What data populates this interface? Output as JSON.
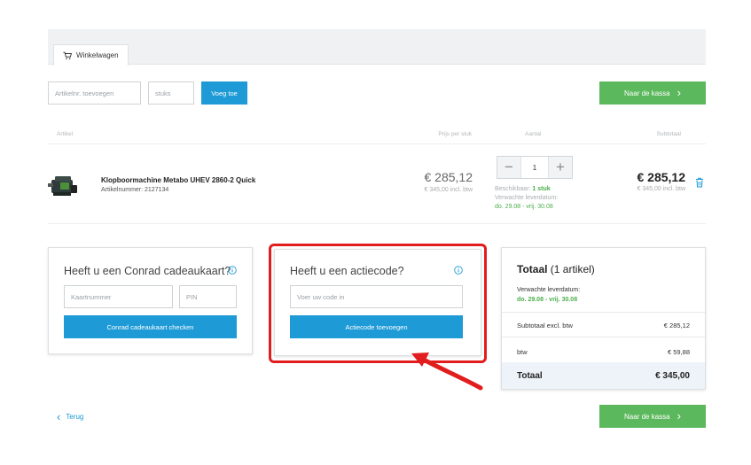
{
  "tab": {
    "label": "Winkelwagen",
    "icon": "cart-icon"
  },
  "add_row": {
    "article_placeholder": "Artikelnr. toevoegen",
    "qty_placeholder": "stuks",
    "add_label": "Voeg toe"
  },
  "checkout_label": "Naar de kassa",
  "table": {
    "headers": {
      "article": "Artikel",
      "price": "Prijs per stuk",
      "qty": "Aantal",
      "subtotal": "Subtotaal"
    }
  },
  "item": {
    "name": "Klopboormachine Metabo UHEV 2860-2 Quick",
    "number": "Artikelnummer: 2127134",
    "price": "€ 285,12",
    "price_incl": "€ 345,00 incl. btw",
    "qty": "1",
    "avail_label": "Beschikbaar:",
    "avail_value": "1 stuk",
    "delivery_label": "Verwachte leverdatum:",
    "delivery_value": "do. 29.08 - vrij. 30.08",
    "subtotal": "€ 285,12",
    "subtotal_incl": "€ 345,00 incl. btw"
  },
  "gift_card": {
    "title": "Heeft u een Conrad cadeaukaart?",
    "card_placeholder": "Kaartnummer",
    "pin_placeholder": "PIN",
    "button": "Conrad cadeaukaart checken"
  },
  "promo": {
    "title": "Heeft u een actiecode?",
    "placeholder": "Voer uw code in",
    "button": "Actiecode toevoegen"
  },
  "totals": {
    "title_bold": "Totaal",
    "title_rest": " (1 artikel)",
    "delivery_label": "Verwachte leverdatum:",
    "delivery_value": "do. 29.08 - vrij. 30.08",
    "subtotal_label": "Subtotaal excl. btw",
    "subtotal_value": "€ 285,12",
    "vat_label": "btw",
    "vat_value": "€ 59,88",
    "total_label": "Totaal",
    "total_value": "€ 345,00"
  },
  "back_label": "Terug",
  "colors": {
    "accent_blue": "#1e9ad6",
    "checkout_green": "#5cb85c",
    "highlight_red": "#e11d1d",
    "availability_green": "#4cae4c"
  }
}
